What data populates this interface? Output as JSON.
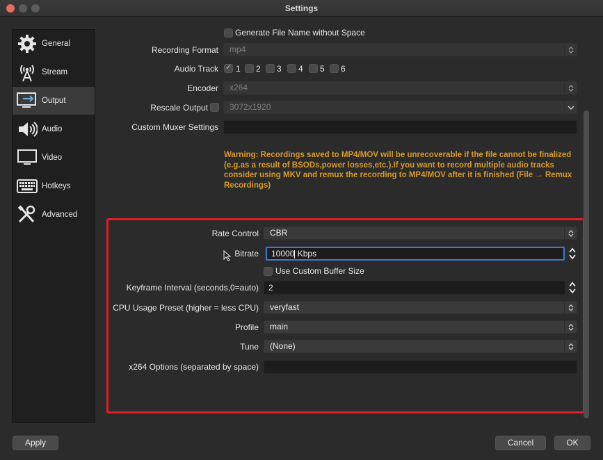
{
  "window": {
    "title": "Settings"
  },
  "sidebar": {
    "items": [
      {
        "label": "General",
        "icon": "gear-icon"
      },
      {
        "label": "Stream",
        "icon": "broadcast-tower-icon"
      },
      {
        "label": "Output",
        "icon": "output-monitor-icon",
        "active": true
      },
      {
        "label": "Audio",
        "icon": "speaker-icon"
      },
      {
        "label": "Video",
        "icon": "monitor-icon"
      },
      {
        "label": "Hotkeys",
        "icon": "keyboard-icon"
      },
      {
        "label": "Advanced",
        "icon": "tools-icon"
      }
    ]
  },
  "recording": {
    "generate_filename_label": "Generate File Name without Space",
    "format_label": "Recording Format",
    "format_value": "mp4",
    "audio_track_label": "Audio Track",
    "tracks": [
      "1",
      "2",
      "3",
      "4",
      "5",
      "6"
    ],
    "encoder_label": "Encoder",
    "encoder_value": "x264",
    "rescale_label": "Rescale Output",
    "rescale_value": "3072x1920",
    "muxer_label": "Custom Muxer Settings",
    "muxer_value": "",
    "warning": "Warning: Recordings saved to MP4/MOV will be unrecoverable if the file cannot be finalized (e.g.as a result of BSODs,power losses,etc.).If you want to record multiple audio tracks consider using MKV and remux the recording to MP4/MOV after it is finished (File → Remux Recordings)"
  },
  "encoder_settings": {
    "rate_control_label": "Rate Control",
    "rate_control_value": "CBR",
    "bitrate_label": "Bitrate",
    "bitrate_value": "10000",
    "bitrate_unit": "Kbps",
    "custom_buffer_label": "Use Custom Buffer Size",
    "keyframe_label": "Keyframe Interval (seconds,0=auto)",
    "keyframe_value": "2",
    "cpu_preset_label": "CPU Usage Preset (higher = less CPU)",
    "cpu_preset_value": "veryfast",
    "profile_label": "Profile",
    "profile_value": "main",
    "tune_label": "Tune",
    "tune_value": "(None)",
    "x264_options_label": "x264 Options (separated by space)",
    "x264_options_value": ""
  },
  "footer": {
    "apply_label": "Apply",
    "cancel_label": "Cancel",
    "ok_label": "OK"
  },
  "colors": {
    "warning": "#d89a2b",
    "highlight": "#e11d26",
    "focus": "#3a7bd5"
  }
}
